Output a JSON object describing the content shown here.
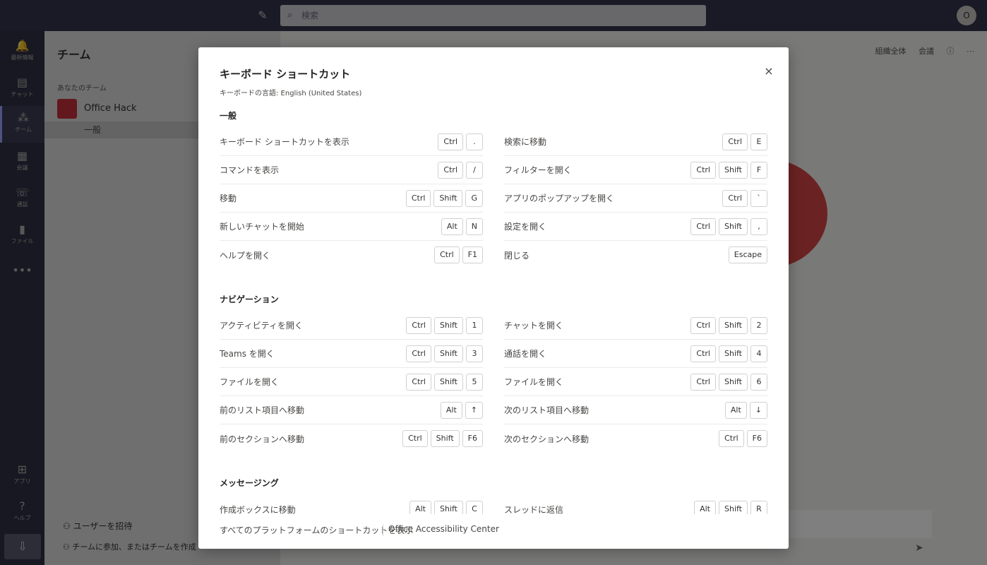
{
  "topbar": {
    "search_placeholder": "検索",
    "avatar_initial": "O"
  },
  "rail": {
    "items": [
      {
        "label": "最新情報",
        "icon": "bell-icon"
      },
      {
        "label": "チャット",
        "icon": "chat-icon"
      },
      {
        "label": "チーム",
        "icon": "teams-icon"
      },
      {
        "label": "会議",
        "icon": "calendar-icon"
      },
      {
        "label": "通話",
        "icon": "phone-icon"
      },
      {
        "label": "ファイル",
        "icon": "file-icon"
      },
      {
        "label": "アプリ",
        "icon": "apps-icon"
      },
      {
        "label": "ヘルプ",
        "icon": "help-icon"
      }
    ],
    "more": "•••"
  },
  "teampanel": {
    "title": "チーム",
    "section": "あなたのチーム",
    "team_name": "Office Hack",
    "channel": "一般",
    "invite": "ユーザーを招待",
    "join": "チームに参加、またはチームを作成"
  },
  "main": {
    "org_wide": "組織全体",
    "meet": "会議"
  },
  "dialog": {
    "title": "キーボード ショートカット",
    "subtitle": "キーボードの言語: English (United States)",
    "close": "×",
    "sections": [
      {
        "title": "一般",
        "left": [
          {
            "label": "キーボード ショートカットを表示",
            "keys": [
              "Ctrl",
              "."
            ]
          },
          {
            "label": "コマンドを表示",
            "keys": [
              "Ctrl",
              "/"
            ]
          },
          {
            "label": "移動",
            "keys": [
              "Ctrl",
              "Shift",
              "G"
            ]
          },
          {
            "label": "新しいチャットを開始",
            "keys": [
              "Alt",
              "N"
            ]
          },
          {
            "label": "ヘルプを開く",
            "keys": [
              "Ctrl",
              "F1"
            ]
          }
        ],
        "right": [
          {
            "label": "検索に移動",
            "keys": [
              "Ctrl",
              "E"
            ]
          },
          {
            "label": "フィルターを開く",
            "keys": [
              "Ctrl",
              "Shift",
              "F"
            ]
          },
          {
            "label": "アプリのポップアップを開く",
            "keys": [
              "Ctrl",
              "`"
            ]
          },
          {
            "label": "設定を開く",
            "keys": [
              "Ctrl",
              "Shift",
              ","
            ]
          },
          {
            "label": "閉じる",
            "keys": [
              "Escape"
            ]
          }
        ]
      },
      {
        "title": "ナビゲーション",
        "left": [
          {
            "label": "アクティビティを開く",
            "keys": [
              "Ctrl",
              "Shift",
              "1"
            ]
          },
          {
            "label": "Teams を開く",
            "keys": [
              "Ctrl",
              "Shift",
              "3"
            ]
          },
          {
            "label": "ファイルを開く",
            "keys": [
              "Ctrl",
              "Shift",
              "5"
            ]
          },
          {
            "label": "前のリスト項目へ移動",
            "keys": [
              "Alt",
              "↑"
            ]
          },
          {
            "label": "前のセクションへ移動",
            "keys": [
              "Ctrl",
              "Shift",
              "F6"
            ]
          }
        ],
        "right": [
          {
            "label": "チャットを開く",
            "keys": [
              "Ctrl",
              "Shift",
              "2"
            ]
          },
          {
            "label": "通話を開く",
            "keys": [
              "Ctrl",
              "Shift",
              "4"
            ]
          },
          {
            "label": "ファイルを開く",
            "keys": [
              "Ctrl",
              "Shift",
              "6"
            ]
          },
          {
            "label": "次のリスト項目へ移動",
            "keys": [
              "Alt",
              "↓"
            ]
          },
          {
            "label": "次のセクションへ移動",
            "keys": [
              "Ctrl",
              "F6"
            ]
          }
        ]
      },
      {
        "title": "メッセージング",
        "left": [
          {
            "label": "作成ボックスに移動",
            "keys": [
              "Alt",
              "Shift",
              "C"
            ]
          }
        ],
        "right": [
          {
            "label": "スレッドに返信",
            "keys": [
              "Alt",
              "Shift",
              "R"
            ]
          }
        ]
      }
    ],
    "footer": {
      "all_platforms": "すべてのプラットフォームのショートカットを表示",
      "accessibility": "Office Accessibility Center"
    }
  }
}
